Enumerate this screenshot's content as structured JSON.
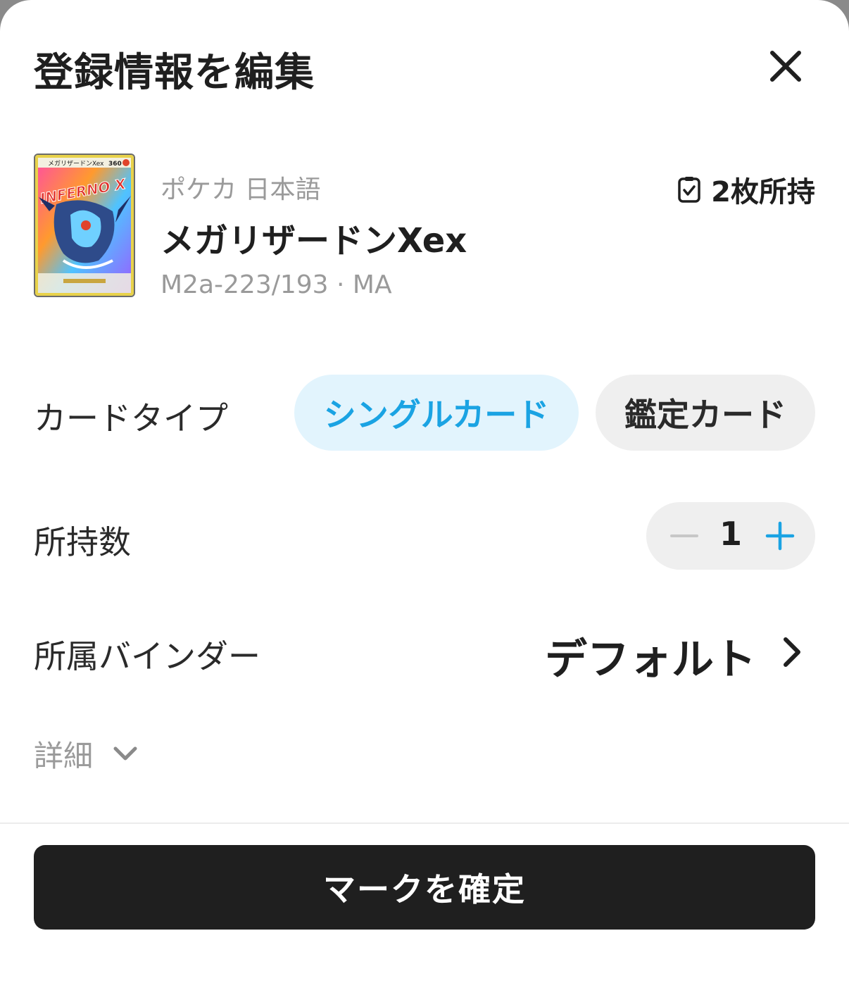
{
  "header": {
    "title": "登録情報を編集",
    "close_icon": "close-icon"
  },
  "card": {
    "game": "ポケカ 日本語",
    "name": "メガリザードンXex",
    "number": "M2a-223/193 · MA",
    "owned_label": "2枚所持",
    "owned_icon": "checklist-icon",
    "art": {
      "title_text": "INFERNO X",
      "hp": "360",
      "card_title": "メガリザードンXex"
    }
  },
  "card_type": {
    "label": "カードタイプ",
    "options": [
      "シングルカード",
      "鑑定カード"
    ],
    "selected": "シングルカード",
    "accent_color": "#1aa3e3"
  },
  "quantity": {
    "label": "所持数",
    "value": "1",
    "minus_icon": "minus-icon",
    "plus_icon": "plus-icon"
  },
  "binder": {
    "label": "所属バインダー",
    "value": "デフォルト",
    "icon": "chevron-right-icon"
  },
  "details": {
    "label": "詳細",
    "icon": "chevron-down-icon"
  },
  "confirm": {
    "label": "マークを確定"
  }
}
